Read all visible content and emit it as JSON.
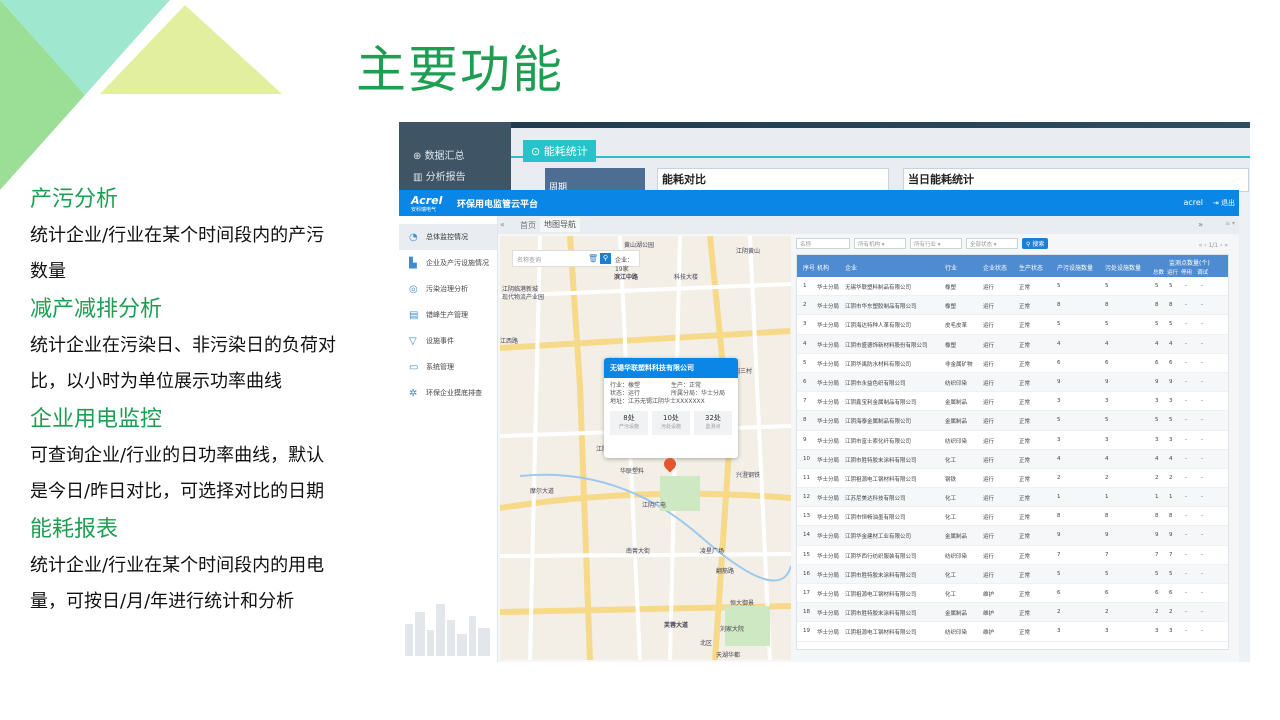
{
  "slide": {
    "title": "主要功能",
    "sections": [
      {
        "heading": "产污分析",
        "text": "统计企业/行业在某个时间段内的产污数量"
      },
      {
        "heading": "减产减排分析",
        "text": "统计企业在污染日、非污染日的负荷对比，以小时为单位展示功率曲线"
      },
      {
        "heading": "企业用电监控",
        "text": "可查询企业/行业的日功率曲线，默认是今日/昨日对比，可选择对比的日期"
      },
      {
        "heading": "能耗报表",
        "text": "统计企业/行业在某个时间段内的用电量，可按日/月/年进行统计和分析"
      }
    ],
    "colors": {
      "accent": "#1e9e52",
      "deco_teal": "#8fe3c8",
      "deco_yellow": "#e2ef9e",
      "deco_green": "#8fdc8a"
    }
  },
  "back_window": {
    "sidebar": [
      "数据汇总",
      "分析报告"
    ],
    "tab": "能耗统计",
    "blue_label": "周期",
    "card1": "能耗对比",
    "card2": "当日能耗统计"
  },
  "app": {
    "brand": "Acrel",
    "brand_sub": "安科瑞电气",
    "title": "环保用电监管云平台",
    "user": "acrel",
    "logout": "退出",
    "nav": [
      {
        "label": "总体监控情况",
        "icon": "dashboard-icon",
        "active": true
      },
      {
        "label": "企业及产污设施情况",
        "icon": "factory-icon"
      },
      {
        "label": "污染治理分析",
        "icon": "target-icon"
      },
      {
        "label": "错峰生产管理",
        "icon": "chart-icon"
      },
      {
        "label": "设施事件",
        "icon": "event-icon"
      },
      {
        "label": "系统管理",
        "icon": "system-icon"
      },
      {
        "label": "环保企业摸底排查",
        "icon": "settings-icon"
      }
    ],
    "tabs": {
      "home": "首页",
      "map": "地图导航"
    },
    "map": {
      "search_placeholder": "名称查询",
      "count": "企业：19家",
      "popup": {
        "title": "无锡华联塑料科技有限公司",
        "industry": "行业：橡塑",
        "production": "生产：正常",
        "status": "状态：运行",
        "branch": "所属分局：华士分局",
        "address": "地址：江苏无锡江阴华士XXXXXXX",
        "stats": [
          {
            "value": "8处",
            "label": "产污设施"
          },
          {
            "value": "10处",
            "label": "污处设施"
          },
          {
            "value": "32处",
            "label": "监测点"
          }
        ]
      },
      "labels": [
        "黄山湖公园",
        "江阴黄山",
        "滨江中路",
        "科技大楼",
        "江阴临港新城",
        "现代物流产业园",
        "江西路",
        "定波新村",
        "无锡华联塑料科技有限公司",
        "江阴双箭酒店",
        "华联塑料",
        "摩尔大道",
        "江阴广电",
        "南菁大街",
        "凌星广场",
        "翻筋路",
        "兴澄钢铁",
        "芙蓉大道",
        "花园三村",
        "北区",
        "天湖华都",
        "刘家大院",
        "恒大御景"
      ]
    },
    "filters": {
      "name": "名称",
      "org": "所有机构",
      "industry": "所有行业",
      "status": "全部状态",
      "search": "搜索",
      "pager": "«  ‹ 1/1 › »"
    },
    "table": {
      "headers": [
        "序号",
        "机构",
        "企业",
        "行业",
        "企业状态",
        "生产状态",
        "产污设施数量",
        "污处设施数量"
      ],
      "monitor_header": "监测点数量(个)",
      "monitor_sub": [
        "总数",
        "运行",
        "停用",
        "调试"
      ],
      "rows": [
        [
          "1",
          "华士分局",
          "无锡华联塑料制品有限公司",
          "橡塑",
          "运行",
          "正常",
          "5",
          "5",
          "5",
          "5",
          "-",
          "-"
        ],
        [
          "2",
          "华士分局",
          "江阴市华东塑胶制品有限公司",
          "橡塑",
          "运行",
          "正常",
          "8",
          "8",
          "8",
          "8",
          "-",
          "-"
        ],
        [
          "3",
          "华士分局",
          "江阴海达特种人革有限公司",
          "皮毛皮革",
          "运行",
          "正常",
          "5",
          "5",
          "5",
          "5",
          "-",
          "-"
        ],
        [
          "4",
          "华士分局",
          "江阴市盛德饰新材料股份有限公司",
          "橡塑",
          "运行",
          "正常",
          "4",
          "4",
          "4",
          "4",
          "-",
          "-"
        ],
        [
          "5",
          "华士分局",
          "江阴华禹防水材料有限公司",
          "非金属矿物",
          "运行",
          "正常",
          "6",
          "6",
          "6",
          "6",
          "-",
          "-"
        ],
        [
          "6",
          "华士分局",
          "江阴市永益色织有限公司",
          "纺织印染",
          "运行",
          "正常",
          "9",
          "9",
          "9",
          "9",
          "-",
          "-"
        ],
        [
          "7",
          "华士分局",
          "江阴鑫宝利金属制品有限公司",
          "金属制品",
          "运行",
          "正常",
          "3",
          "3",
          "3",
          "3",
          "-",
          "-"
        ],
        [
          "8",
          "华士分局",
          "江阴海泰金属制品有限公司",
          "金属制品",
          "运行",
          "正常",
          "5",
          "5",
          "5",
          "5",
          "-",
          "-"
        ],
        [
          "9",
          "华士分局",
          "江阴市富士索化纤有限公司",
          "纺织印染",
          "运行",
          "正常",
          "3",
          "3",
          "3",
          "3",
          "-",
          "-"
        ],
        [
          "10",
          "华士分局",
          "江阴市胜特胶末涂料有限公司",
          "化工",
          "运行",
          "正常",
          "4",
          "4",
          "4",
          "4",
          "-",
          "-"
        ],
        [
          "11",
          "华士分局",
          "江阴祖源电工钢材料有限公司",
          "钢铁",
          "运行",
          "正常",
          "2",
          "2",
          "2",
          "2",
          "-",
          "-"
        ],
        [
          "12",
          "华士分局",
          "江苏尼美达科技有限公司",
          "化工",
          "运行",
          "正常",
          "1",
          "1",
          "1",
          "1",
          "-",
          "-"
        ],
        [
          "13",
          "华士分局",
          "江阴市恒畅油墨有限公司",
          "化工",
          "运行",
          "正常",
          "8",
          "8",
          "8",
          "8",
          "-",
          "-"
        ],
        [
          "14",
          "华士分局",
          "江阴华金建材工业有限公司",
          "金属制品",
          "运行",
          "正常",
          "9",
          "9",
          "9",
          "9",
          "-",
          "-"
        ],
        [
          "15",
          "华士分局",
          "江阴华西行纺织服装有限公司",
          "纺织印染",
          "运行",
          "正常",
          "7",
          "7",
          "7",
          "7",
          "-",
          "-"
        ],
        [
          "16",
          "华士分局",
          "江阴市胜特胶末涂料有限公司",
          "化工",
          "运行",
          "正常",
          "5",
          "5",
          "5",
          "5",
          "-",
          "-"
        ],
        [
          "17",
          "华士分局",
          "江阴祖源电工钢材料有限公司",
          "化工",
          "维护",
          "正常",
          "6",
          "6",
          "6",
          "6",
          "-",
          "-"
        ],
        [
          "18",
          "华士分局",
          "江阴市胜特胶末涂料有限公司",
          "金属制品",
          "维护",
          "正常",
          "2",
          "2",
          "2",
          "2",
          "-",
          "-"
        ],
        [
          "19",
          "华士分局",
          "江阴祖源电工钢材料有限公司",
          "纺织印染",
          "维护",
          "正常",
          "3",
          "3",
          "3",
          "3",
          "-",
          "-"
        ]
      ]
    }
  }
}
